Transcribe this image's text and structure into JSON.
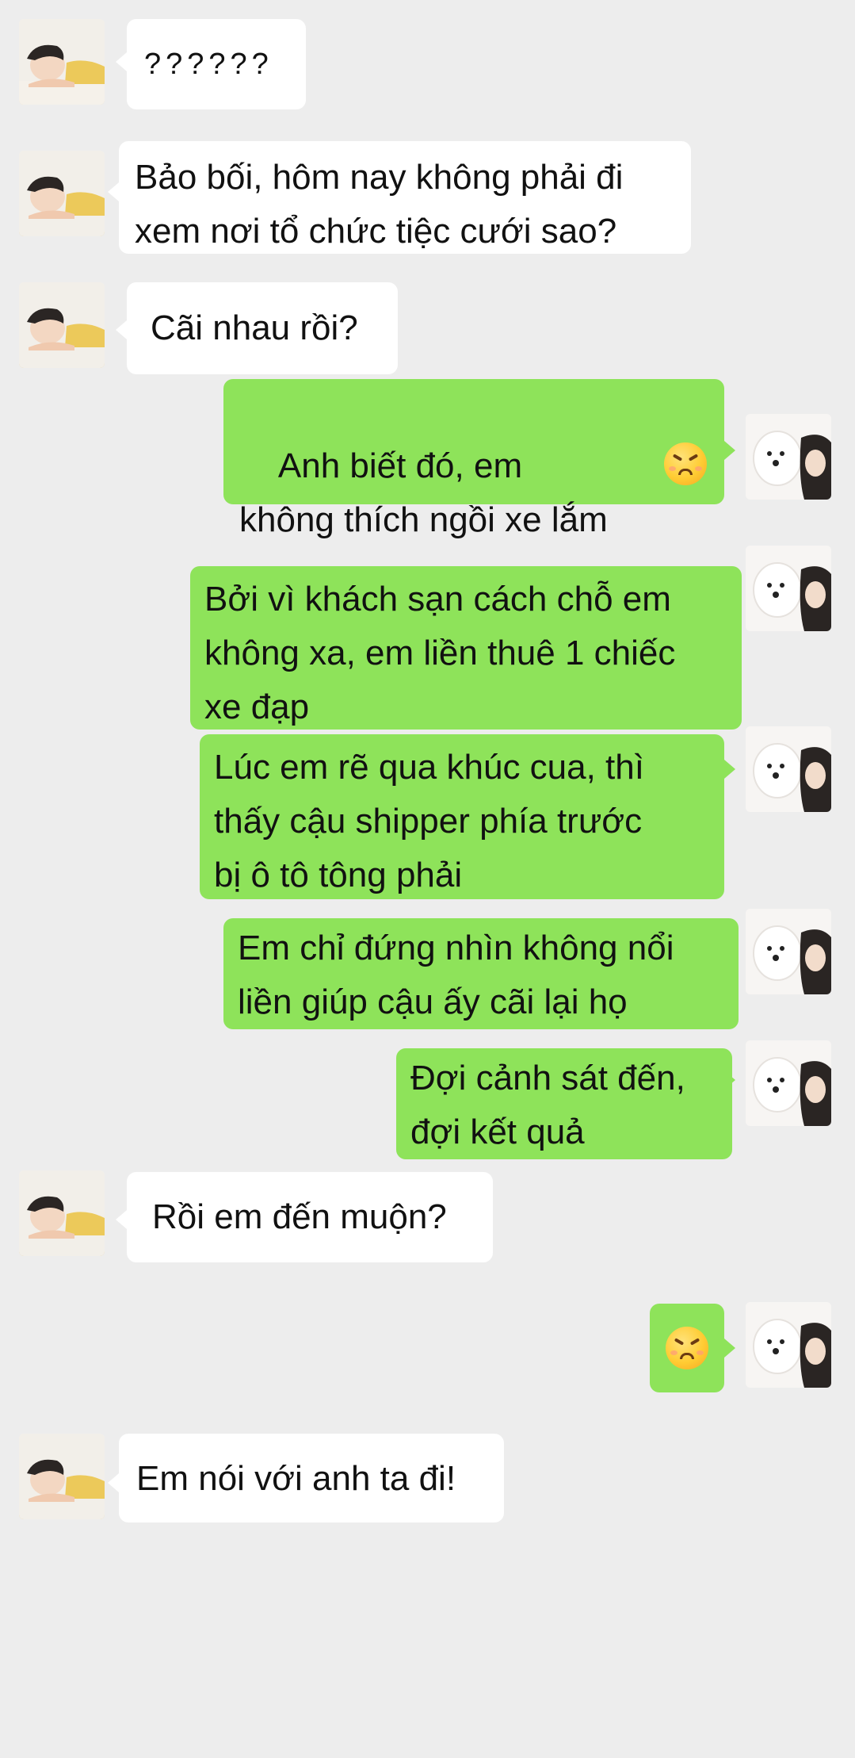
{
  "messages": [
    {
      "side": "in",
      "text": "??????"
    },
    {
      "side": "in",
      "text": "Bảo bối, hôm nay không phải đi\nxem nơi tổ chức tiệc cưới sao?"
    },
    {
      "side": "in",
      "text": "Cãi nhau rồi?"
    },
    {
      "side": "out",
      "text": "Anh biết đó, em\nkhông thích ngồi xe lắm",
      "emoji": "persevering-face-emoji"
    },
    {
      "side": "out",
      "text": "Bởi vì khách sạn cách chỗ em\nkhông xa, em liền thuê 1 chiếc\nxe đạp"
    },
    {
      "side": "out",
      "text": "Lúc em rẽ qua khúc cua, thì\nthấy cậu shipper phía trước\nbị ô tô tông phải"
    },
    {
      "side": "out",
      "text": "Em chỉ đứng nhìn không nổi\nliền giúp cậu ấy cãi lại họ"
    },
    {
      "side": "out",
      "text": "Đợi cảnh sát đến,\nđợi kết quả"
    },
    {
      "side": "in",
      "text": "Rồi em đến muộn?"
    },
    {
      "side": "out",
      "text": "",
      "emoji": "persevering-face-emoji"
    },
    {
      "side": "in",
      "text": "Em nói với anh ta đi!"
    }
  ],
  "colors": {
    "background": "#ededed",
    "incoming_bubble": "#ffffff",
    "outgoing_bubble": "#8ee35a"
  },
  "avatars": {
    "incoming": "boy-avatar",
    "outgoing": "dog-and-girl-avatar"
  }
}
